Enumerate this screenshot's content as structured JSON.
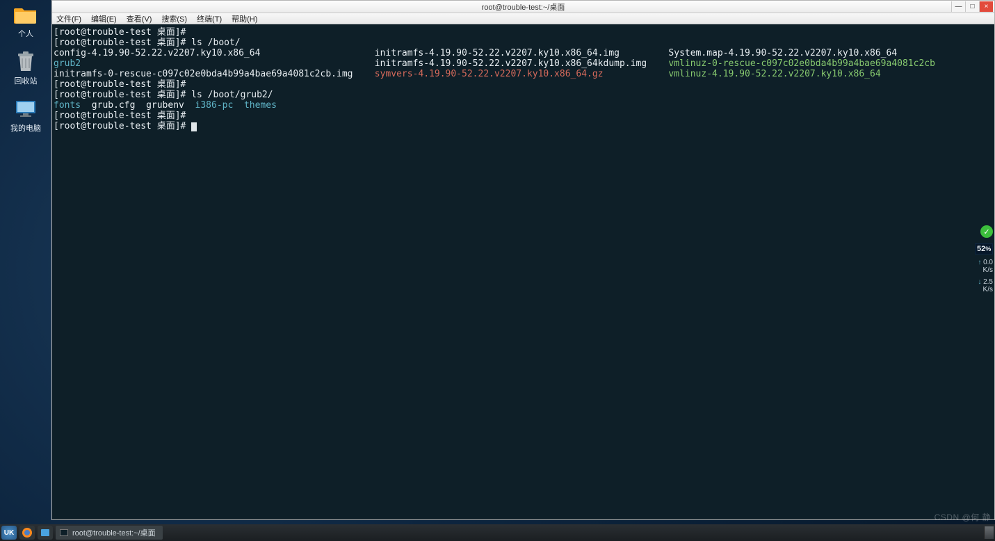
{
  "desktop": {
    "icons": [
      {
        "name": "folder",
        "label": "个人"
      },
      {
        "name": "trash",
        "label": "回收站"
      },
      {
        "name": "computer",
        "label": "我的电脑"
      }
    ]
  },
  "window": {
    "title": "root@trouble-test:~/桌面",
    "buttons": {
      "min": "—",
      "max": "□",
      "close": "×"
    },
    "menu": [
      "文件(F)",
      "编辑(E)",
      "查看(V)",
      "搜索(S)",
      "终端(T)",
      "帮助(H)"
    ]
  },
  "terminal": {
    "prompt": "[root@trouble-test 桌面]#",
    "lines": [
      {
        "segs": [
          {
            "t": "[root@trouble-test 桌面]#",
            "c": "white"
          }
        ]
      },
      {
        "segs": [
          {
            "t": "[root@trouble-test 桌面]# ls /boot/",
            "c": "white"
          }
        ]
      },
      {
        "segs": [
          {
            "t": "config-4.19.90-52.22.v2207.ky10.x86_64                     ",
            "c": "white"
          },
          {
            "t": "initramfs-4.19.90-52.22.v2207.ky10.x86_64.img         ",
            "c": "white"
          },
          {
            "t": "System.map-4.19.90-52.22.v2207.ky10.x86_64",
            "c": "white"
          }
        ]
      },
      {
        "segs": [
          {
            "t": "grub2                                                      ",
            "c": "cyan"
          },
          {
            "t": "initramfs-4.19.90-52.22.v2207.ky10.x86_64kdump.img    ",
            "c": "white"
          },
          {
            "t": "vmlinuz-0-rescue-c097c02e0bda4b99a4bae69a4081c2cb",
            "c": "green"
          }
        ]
      },
      {
        "segs": [
          {
            "t": "initramfs-0-rescue-c097c02e0bda4b99a4bae69a4081c2cb.img    ",
            "c": "white"
          },
          {
            "t": "symvers-4.19.90-52.22.v2207.ky10.x86_64.gz            ",
            "c": "red"
          },
          {
            "t": "vmlinuz-4.19.90-52.22.v2207.ky10.x86_64",
            "c": "green"
          }
        ]
      },
      {
        "segs": [
          {
            "t": "[root@trouble-test 桌面]#",
            "c": "white"
          }
        ]
      },
      {
        "segs": [
          {
            "t": "[root@trouble-test 桌面]# ls /boot/grub2/",
            "c": "white"
          }
        ]
      },
      {
        "segs": [
          {
            "t": "fonts  ",
            "c": "cyan"
          },
          {
            "t": "grub.cfg  grubenv  ",
            "c": "white"
          },
          {
            "t": "i386-pc  themes",
            "c": "cyan"
          }
        ]
      },
      {
        "segs": [
          {
            "t": "[root@trouble-test 桌面]#",
            "c": "white"
          }
        ]
      },
      {
        "segs": [
          {
            "t": "[root@trouble-test 桌面]# ",
            "c": "white"
          }
        ],
        "cursor": true
      }
    ]
  },
  "right_overlay": {
    "shield_check": "✓",
    "percent": "52",
    "percent_unit": "%",
    "net_up": "0.0",
    "net_up_unit": "K/s",
    "net_dn": "2.5",
    "net_dn_unit": "K/s"
  },
  "taskbar": {
    "start": "UK",
    "task_label": "root@trouble-test:~/桌面",
    "tray_time": ""
  },
  "watermark": "CSDN @何 静"
}
